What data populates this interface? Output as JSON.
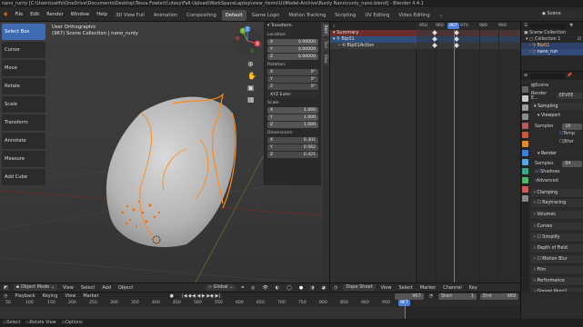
{
  "titlebar": {
    "text": "nano_runty [C:\\Users\\sallfo\\OneDrive\\Documents\\Desktop\\Tessa Fowler\\Cutesy\\Fall-Upload\\WorkSpaceLaptop\\view_items\\Ui\\Model-Archive\\Runty Nano\\runty_nano.blend] - Blender 4.4.1"
  },
  "menu": [
    "File",
    "Edit",
    "Render",
    "Window",
    "Help"
  ],
  "workspaces": [
    "3D View Full",
    "Animation",
    "Compositing",
    "Default",
    "Game Logic",
    "Motion Tracking",
    "Scripting",
    "UV Editing",
    "Video Editing"
  ],
  "scene_name": "Scene",
  "tools": [
    "Select Box",
    "Cursor",
    "Move",
    "Rotate",
    "Scale",
    "Transform",
    "Annotate",
    "Measure",
    "Add Cube"
  ],
  "viewport": {
    "view_name": "User Orthographic",
    "collection_info": "(967) Scene Collection | nano_runty",
    "gizmo": {
      "x": "X",
      "y": "Y",
      "z": "Z"
    }
  },
  "npanel": {
    "title": "Transform",
    "location_label": "Location:",
    "location": [
      [
        "X",
        "0.00000"
      ],
      [
        "Y",
        "0.00000"
      ],
      [
        "Z",
        "0.00000"
      ]
    ],
    "rotation_label": "Rotation:",
    "rotation": [
      [
        "X",
        "0°"
      ],
      [
        "Y",
        "0°"
      ],
      [
        "Z",
        "0°"
      ]
    ],
    "rotation_mode": "XYZ Euler",
    "scale_label": "Scale:",
    "scale": [
      [
        "X",
        "1.000"
      ],
      [
        "Y",
        "1.000"
      ],
      [
        "Z",
        "1.000"
      ]
    ],
    "dimensions_label": "Dimensions:",
    "dimensions": [
      [
        "X",
        "0.301"
      ],
      [
        "Y",
        "0.562"
      ],
      [
        "Z",
        "0.421"
      ]
    ],
    "tabs": [
      "Item",
      "Tool",
      "View"
    ]
  },
  "viewport_header": {
    "mode": "Object Mode",
    "menus": [
      "View",
      "Select",
      "Add",
      "Object"
    ],
    "orientation": "Global"
  },
  "dope_sheet": {
    "ruler": [
      "950",
      "960",
      "967",
      "970",
      "980",
      "990"
    ],
    "current_frame": "967",
    "channels": [
      "Summary",
      "Bip01",
      "Bip01Action"
    ],
    "header": {
      "editor": "Dope Sheet",
      "menus": [
        "View",
        "Select",
        "Marker",
        "Channel",
        "Key"
      ]
    }
  },
  "outliner": {
    "items": [
      "Scene Collection",
      "Collection 1",
      "Bip01",
      "nano_run"
    ]
  },
  "properties": {
    "scene_label": "Scene",
    "render_engine_label": "Render E...",
    "render_engine": "EEVEE",
    "sections": [
      "Sampling",
      "Viewport",
      "Samples",
      "Temp",
      "Jitter",
      "Render",
      "Samples",
      "Shadows",
      "Advanced",
      "Clamping",
      "Raytracing",
      "Volumes",
      "Curves",
      "Simplify",
      "Depth of Field",
      "Motion Blur",
      "Film",
      "Performance",
      "Grease Pencil"
    ],
    "viewport_samples": "16",
    "render_samples": "64"
  },
  "timeline": {
    "menus": [
      "Playback",
      "Keying",
      "View",
      "Marker"
    ],
    "current_frame": "967",
    "start_label": "Start",
    "start": "1",
    "end_label": "End",
    "end": "969",
    "ruler": [
      "50",
      "100",
      "150",
      "200",
      "250",
      "300",
      "350",
      "400",
      "450",
      "500",
      "550",
      "600",
      "650",
      "700",
      "750",
      "800",
      "850",
      "900",
      "950"
    ],
    "playhead": "967"
  },
  "statusbar": {
    "left": "Select",
    "middle": "Rotate View",
    "right": "Options"
  },
  "colors": {
    "accent": "#3f6bb3",
    "playhead": "#4f7fd6",
    "outline": "#ff8a1a"
  }
}
